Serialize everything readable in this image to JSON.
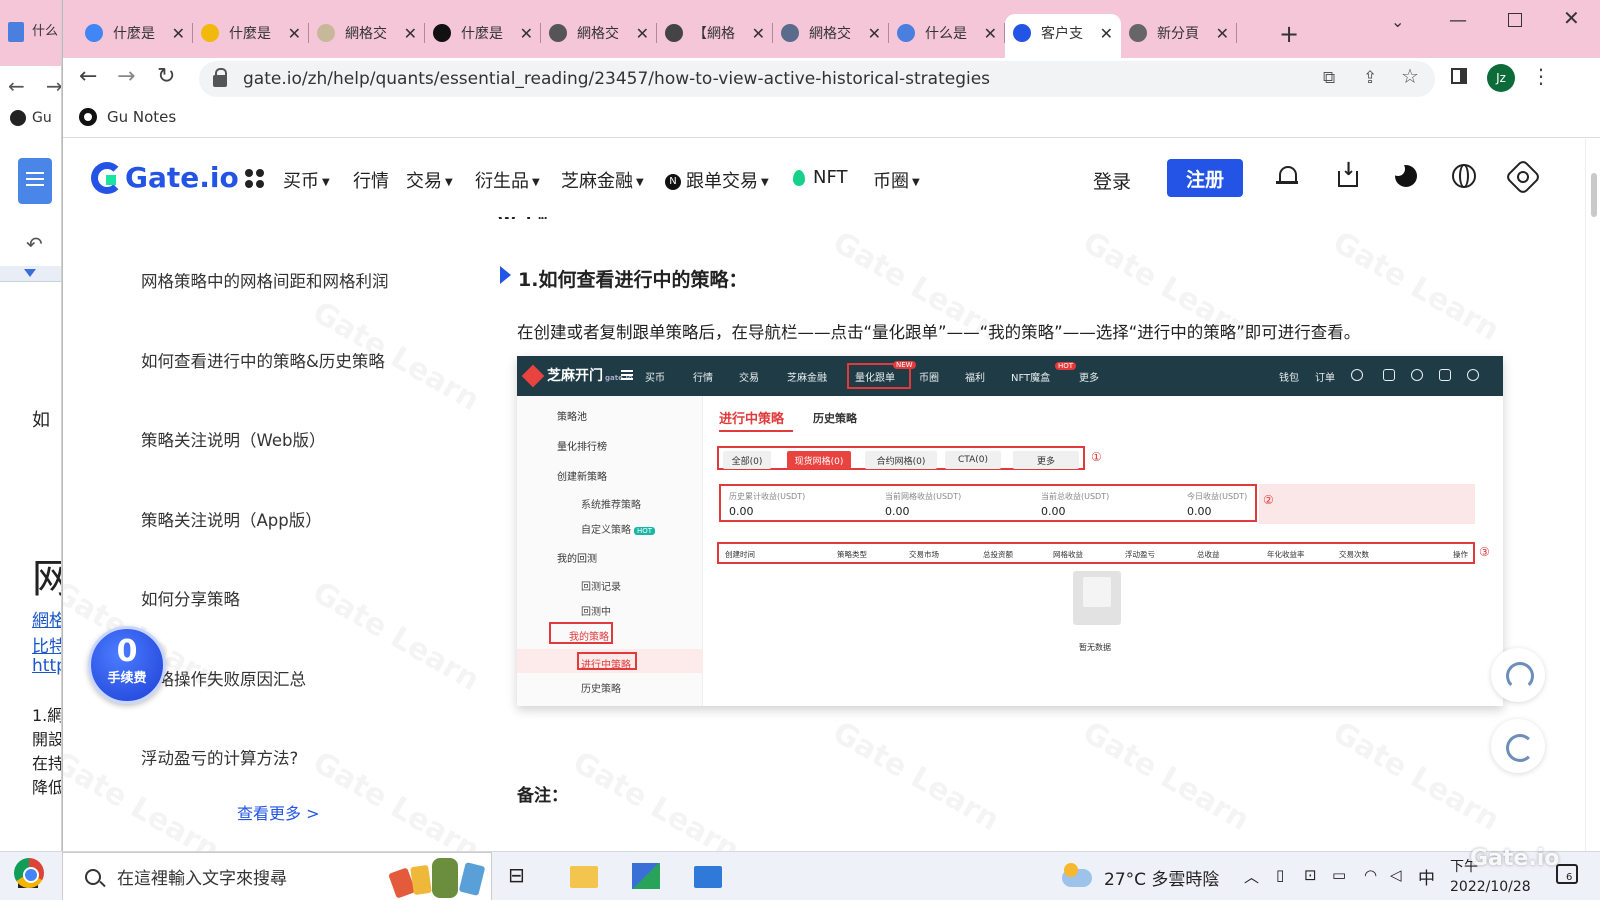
{
  "background_window": {
    "tab_label": "什么",
    "bookmark_label": "Gu",
    "doc_lines": [
      "如",
      "网",
      "網格",
      "比特",
      "http",
      "1.網",
      "開設",
      "在持",
      "降低"
    ]
  },
  "tabs": [
    {
      "label": "什麼是",
      "favicon": "google-icon",
      "color": "#4285f4"
    },
    {
      "label": "什麼是",
      "favicon": "binance-icon",
      "color": "#f0b90b"
    },
    {
      "label": "網格交",
      "favicon": "site-icon",
      "color": "#c8b89a"
    },
    {
      "label": "什麼是",
      "favicon": "medium-icon",
      "color": "#111111"
    },
    {
      "label": "網格交",
      "favicon": "bird-icon",
      "color": "#555555"
    },
    {
      "label": "【網格",
      "favicon": "chatgpt-icon",
      "color": "#444444"
    },
    {
      "label": "網格交",
      "favicon": "hb-icon",
      "color": "#5b6b8c"
    },
    {
      "label": "什么是",
      "favicon": "docs-icon",
      "color": "#4a7fe0"
    },
    {
      "label": "客户支",
      "favicon": "gate-icon",
      "color": "#2354e6",
      "active": true
    },
    {
      "label": "新分頁",
      "favicon": "chrome-icon",
      "color": "#666666"
    }
  ],
  "browser": {
    "url": "gate.io/zh/help/quants/essential_reading/23457/how-to-view-active-historical-strategies",
    "profile_initials": "Jz",
    "bookmark": "Gu Notes"
  },
  "site": {
    "logo_text": "Gate.io",
    "nav": [
      {
        "label": "买币",
        "caret": true
      },
      {
        "label": "行情",
        "caret": false
      },
      {
        "label": "交易",
        "caret": true
      },
      {
        "label": "衍生品",
        "caret": true
      },
      {
        "label": "芝麻金融",
        "caret": true
      },
      {
        "label": "跟单交易",
        "caret": true,
        "prefix": "N"
      },
      {
        "label": "NFT",
        "caret": false,
        "prefix": "leaf"
      },
      {
        "label": "币圈",
        "caret": true
      }
    ],
    "login": "登录",
    "register": "注册"
  },
  "sidebar": {
    "items": [
      "网格策略中的网格间距和网格利润",
      "如何查看进行中的策略&历史策略",
      "策略关注说明（Web版）",
      "策略关注说明（App版）",
      "如何分享策略",
      "策略操作失败原因汇总",
      "浮动盈亏的计算方法?"
    ],
    "view_more": "查看更多 >"
  },
  "fee_badge": {
    "value": "0",
    "label": "手续费"
  },
  "article": {
    "prev_heading": "Web版",
    "heading": "1.如何查看进行中的策略：",
    "text": "在创建或者复制跟单策略后，在导航栏——点击“量化跟单”——“我的策略”——选择“进行中的策略”即可进行查看。",
    "note_label": "备注："
  },
  "embed": {
    "logo": "芝麻开门",
    "logo_sub": "gate.io",
    "nav": [
      "买币",
      "行情",
      "交易",
      "芝麻金融",
      "量化跟单",
      "币圈",
      "福利",
      "NFT魔盒",
      "更多"
    ],
    "nav_right": [
      "钱包",
      "订单"
    ],
    "badge_new": "NEW",
    "badge_hot": "HOT",
    "side": [
      "策略池",
      "量化排行榜",
      "创建新策略",
      "系统推荐策略",
      "自定义策略",
      "我的回测",
      "回测记录",
      "回测中",
      "我的策略",
      "进行中策略",
      "历史策略"
    ],
    "tabs": [
      "进行中策略",
      "历史策略"
    ],
    "filters": [
      "全部(0)",
      "现货网格(0)",
      "合约网格(0)",
      "CTA(0)",
      "更多"
    ],
    "stats": [
      {
        "label": "历史累计收益(USDT)",
        "value": "0.00"
      },
      {
        "label": "当前网格收益(USDT)",
        "value": "0.00"
      },
      {
        "label": "当前总收益(USDT)",
        "value": "0.00"
      },
      {
        "label": "今日收益(USDT)",
        "value": "0.00"
      }
    ],
    "columns": [
      "创建时间",
      "策略类型",
      "交易市场",
      "总投资额",
      "网格收益",
      "浮动盈亏",
      "总收益",
      "年化收益率",
      "交易次数",
      "操作"
    ],
    "empty": "暂无数据",
    "markers": [
      "①",
      "②",
      "③"
    ]
  },
  "taskbar": {
    "search_placeholder": "在這裡輸入文字來搜尋",
    "weather": "27°C 多雲時陰",
    "ime": "中",
    "clock_time": "下午",
    "clock_date": "2022/10/28",
    "notif_count": "6",
    "watermark": "Gate.io"
  },
  "watermark_text": "Gate Learn"
}
